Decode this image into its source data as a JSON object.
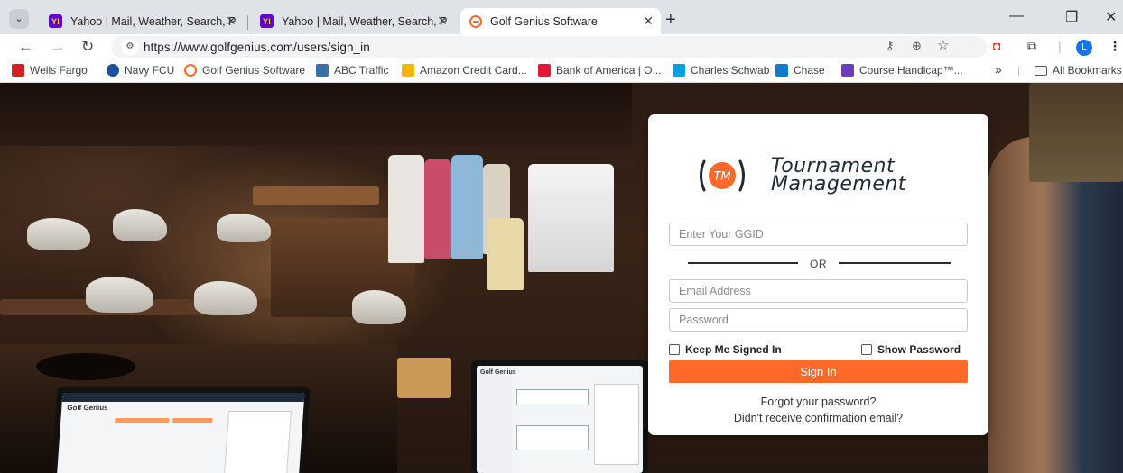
{
  "browser": {
    "tabs": [
      {
        "title": "Yahoo | Mail, Weather, Search, P",
        "favicon": "yahoo-icon",
        "active": false
      },
      {
        "title": "Yahoo | Mail, Weather, Search, P",
        "favicon": "yahoo-icon",
        "active": false
      },
      {
        "title": "Golf Genius Software",
        "favicon": "golf-genius-icon",
        "active": true
      }
    ],
    "url": "https://www.golfgenius.com/users/sign_in",
    "profile_initial": "L",
    "bookmarks": [
      {
        "label": "Wells Fargo",
        "color": "#d71e28"
      },
      {
        "label": "Navy FCU",
        "color": "#1c4f9c"
      },
      {
        "label": "Golf Genius Software",
        "color": "#ff6a2b"
      },
      {
        "label": "ABC Traffic",
        "color": "#3b6ea5"
      },
      {
        "label": "Amazon Credit Card...",
        "color": "#f5b400"
      },
      {
        "label": "Bank of America | O...",
        "color": "#e31837"
      },
      {
        "label": "Charles Schwab",
        "color": "#00a0df"
      },
      {
        "label": "Chase",
        "color": "#117aca"
      },
      {
        "label": "Course Handicap™...",
        "color": "#6a3fb5"
      }
    ],
    "bookmarks_overflow": "»",
    "all_bookmarks": "All Bookmarks"
  },
  "login": {
    "brand_line1": "Tournament",
    "brand_line2": "Management",
    "brand_mark": "TM",
    "ggid_placeholder": "Enter Your GGID",
    "or_text": "OR",
    "email_placeholder": "Email Address",
    "password_placeholder": "Password",
    "keep_signed_in": "Keep Me Signed In",
    "show_password": "Show Password",
    "sign_in": "Sign In",
    "forgot_password": "Forgot your password?",
    "resend_confirmation": "Didn't receive confirmation email?"
  },
  "background": {
    "laptop_brand": "Golf Genius",
    "tablet_brand": "Golf Genius"
  },
  "colors": {
    "accent": "#ff6a2b",
    "text_dark": "#1f2a36"
  }
}
